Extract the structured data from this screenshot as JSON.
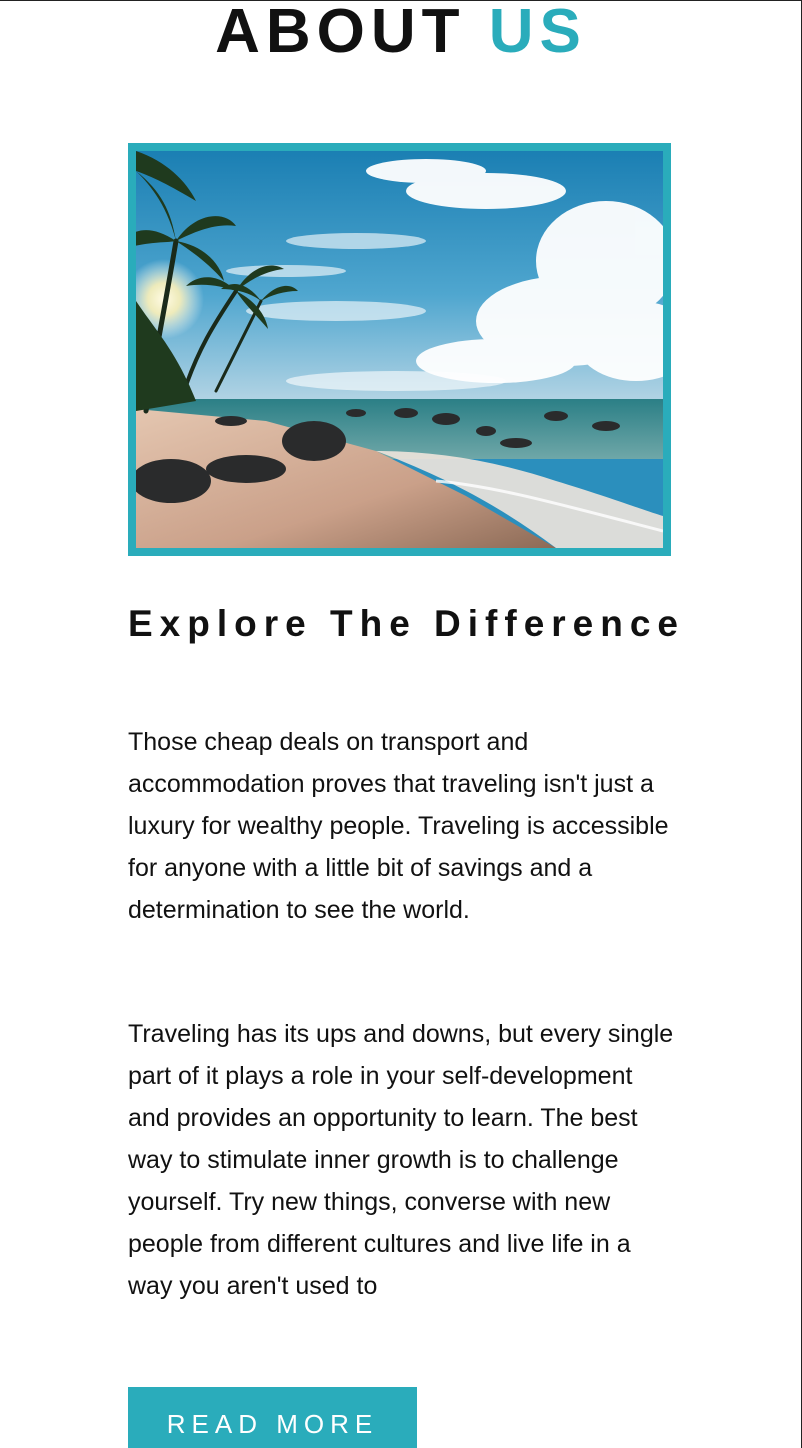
{
  "section": {
    "title_main": "ABOUT",
    "title_accent": "US",
    "accent_color": "#2aacbb"
  },
  "image": {
    "subject": "tropical-beach-photo"
  },
  "content": {
    "heading": "Explore The Difference",
    "paragraph_1": "Those cheap deals on transport and accommodation proves that traveling isn't just a luxury for wealthy people. Traveling is accessible for anyone with a little bit of savings and a determination to see the world.",
    "paragraph_2": "Traveling has its ups and downs, but every single part of it plays a role in your self-development and provides an opportunity to learn. The best way to stimulate inner growth is to challenge yourself. Try new things, converse with new people from different cultures and live life in a way you aren't used to"
  },
  "actions": {
    "read_more_label": "READ MORE"
  }
}
